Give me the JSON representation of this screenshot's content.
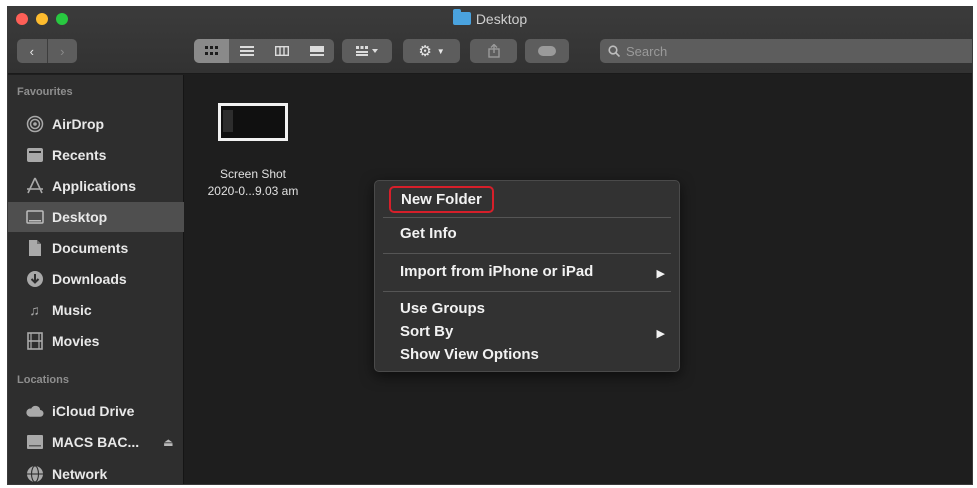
{
  "window": {
    "title": "Desktop",
    "title_icon": "folder-icon"
  },
  "toolbar": {
    "back_icon": "‹",
    "forward_icon": "›",
    "view_icons": [
      "icon-view",
      "list-view",
      "column-view",
      "gallery-view"
    ],
    "group_icon": "group-by-icon",
    "action_icon": "gear-icon",
    "share_icon": "share-icon",
    "tag_icon": "tag-icon",
    "search_placeholder": "Search"
  },
  "sidebar": {
    "favourites_title": "Favourites",
    "favourites": [
      {
        "label": "AirDrop",
        "icon": "airdrop-icon"
      },
      {
        "label": "Recents",
        "icon": "recents-icon"
      },
      {
        "label": "Applications",
        "icon": "applications-icon"
      },
      {
        "label": "Desktop",
        "icon": "desktop-icon",
        "selected": true
      },
      {
        "label": "Documents",
        "icon": "documents-icon"
      },
      {
        "label": "Downloads",
        "icon": "downloads-icon"
      },
      {
        "label": "Music",
        "icon": "music-icon"
      },
      {
        "label": "Movies",
        "icon": "movies-icon"
      }
    ],
    "locations_title": "Locations",
    "locations": [
      {
        "label": "iCloud Drive",
        "icon": "cloud-icon"
      },
      {
        "label": "MACS BAC...",
        "icon": "drive-icon",
        "eject": "⏏"
      },
      {
        "label": "Network",
        "icon": "network-icon"
      }
    ]
  },
  "content": {
    "file": {
      "name_line1": "Screen Shot",
      "name_line2": "2020-0...9.03 am"
    }
  },
  "context_menu": {
    "new_folder": "New Folder",
    "get_info": "Get Info",
    "import": "Import from iPhone or iPad",
    "use_groups": "Use Groups",
    "sort_by": "Sort By",
    "show_view_options": "Show View Options",
    "submenu_arrow": "▶",
    "highlight_color": "#d61f2a"
  }
}
